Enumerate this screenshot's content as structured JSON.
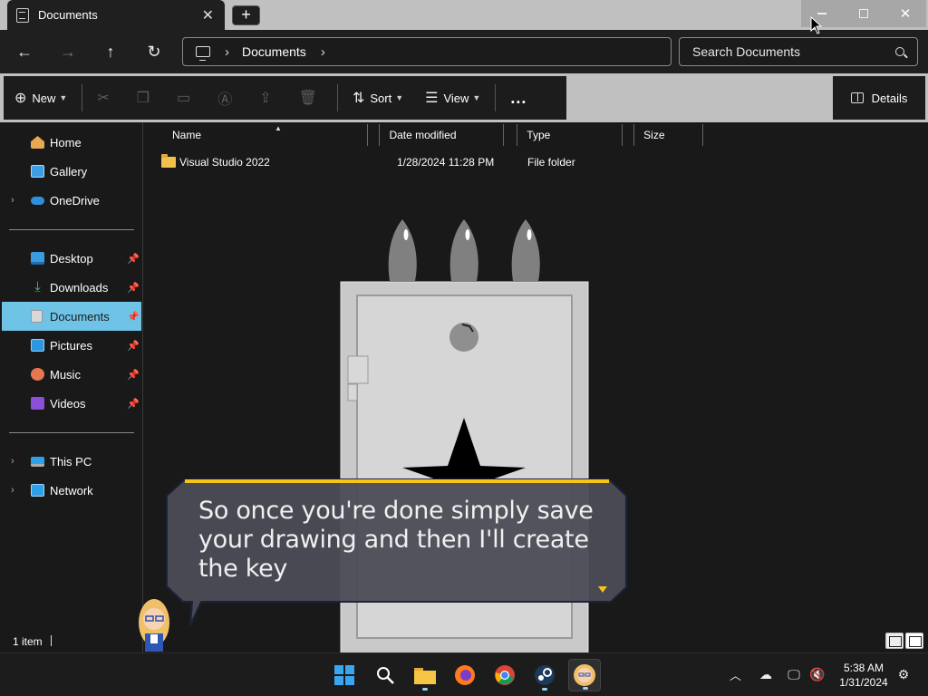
{
  "window": {
    "tab_title": "Documents",
    "new_tab": "+"
  },
  "navigation": {
    "breadcrumb": [
      "Documents"
    ],
    "search_placeholder": "Search Documents"
  },
  "command_bar": {
    "new_label": "New",
    "sort_label": "Sort",
    "view_label": "View",
    "more_label": "...",
    "details_label": "Details"
  },
  "sidebar": {
    "group1": [
      {
        "label": "Home",
        "icon": "home-icon"
      },
      {
        "label": "Gallery",
        "icon": "gallery-icon"
      },
      {
        "label": "OneDrive",
        "icon": "onedrive-icon"
      }
    ],
    "group2": [
      {
        "label": "Desktop",
        "icon": "desktop-icon",
        "pinned": true
      },
      {
        "label": "Downloads",
        "icon": "downloads-icon",
        "pinned": true
      },
      {
        "label": "Documents",
        "icon": "documents-icon",
        "pinned": true,
        "selected": true
      },
      {
        "label": "Pictures",
        "icon": "pictures-icon",
        "pinned": true
      },
      {
        "label": "Music",
        "icon": "music-icon",
        "pinned": true
      },
      {
        "label": "Videos",
        "icon": "videos-icon",
        "pinned": true
      }
    ],
    "group3": [
      {
        "label": "This PC",
        "icon": "this-pc-icon"
      },
      {
        "label": "Network",
        "icon": "network-icon"
      }
    ]
  },
  "file_list": {
    "columns": [
      "Name",
      "Date modified",
      "Type",
      "Size"
    ],
    "rows": [
      {
        "name": "Visual Studio 2022",
        "date_modified": "1/28/2024 11:28 PM",
        "type": "File folder",
        "size": ""
      }
    ]
  },
  "status": {
    "item_count": "1 item"
  },
  "dialogue": {
    "text": "So once you're done simply save your drawing and then I'll create the key"
  },
  "taskbar": {
    "apps": [
      "start-icon",
      "search-icon",
      "file-explorer-icon",
      "firefox-icon",
      "chrome-icon",
      "steam-icon",
      "game-icon"
    ],
    "time": "5:38 AM",
    "date": "1/31/2024"
  },
  "colors": {
    "accent": "#6ec3e6",
    "folder": "#f2c14b",
    "dialogue_border": "#f5c518",
    "dialogue_bg": "#4a4a55"
  }
}
